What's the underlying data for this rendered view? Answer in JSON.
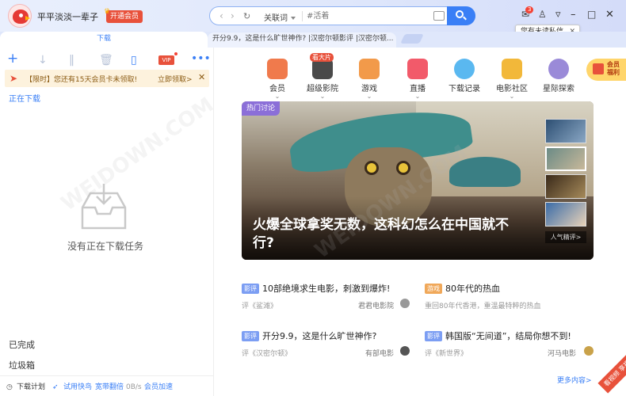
{
  "user": {
    "name": "平平淡淡一辈子",
    "vip_button": "开通会员"
  },
  "search": {
    "keyword_type": "关联词",
    "placeholder": "#活着"
  },
  "notification": {
    "badge": "3",
    "tooltip": "您有未读私信"
  },
  "tabs": [
    {
      "label": "下载"
    },
    {
      "label": "开分9.9，这是什么旷世神作? |汉密尔顿影评 |汉密尔顿..."
    }
  ],
  "toolbar": {
    "vip_label": "VIP"
  },
  "promo": {
    "text": "【限时】您还有15天会员卡未领取!",
    "action": "立即领取>"
  },
  "download": {
    "section_title": "正在下载",
    "empty_text": "没有正在下载任务",
    "completed": "已完成",
    "trash": "垃圾箱"
  },
  "bottom_bar": {
    "plan": "下载计划",
    "speed_label": "试用快鸟",
    "broadband": "宽带翻倍",
    "speed": "0B/s",
    "vip_accel": "会员加速"
  },
  "categories": [
    {
      "label": "会员",
      "color": "#f07a4c",
      "icon": "crown-icon"
    },
    {
      "label": "超级影院",
      "color": "#4a4a4a",
      "icon": "film-icon",
      "badge": "看大片"
    },
    {
      "label": "游戏",
      "color": "#f29a4a",
      "icon": "gamepad-icon"
    },
    {
      "label": "直播",
      "color": "#f25a6a",
      "icon": "tv-icon"
    },
    {
      "label": "下载记录",
      "color": "#5ab8f0",
      "icon": "cloud-icon"
    },
    {
      "label": "电影社区",
      "color": "#f2b83a",
      "icon": "star-icon"
    },
    {
      "label": "星际探索",
      "color": "#9a8ad8",
      "icon": "planet-icon"
    }
  ],
  "vip_corner": {
    "line1": "会员",
    "line2": "福利"
  },
  "banner": {
    "tag": "热门讨论",
    "title": "火爆全球拿奖无数，这科幻怎么在中国就不行?",
    "side_label": "人气精评>"
  },
  "news": [
    {
      "badge": "影评",
      "badge_color": "#7c9ef3",
      "title": "10部绝境求生电影，刺激到爆炸!",
      "sub": "评《鲨滩》",
      "source": "君君电影院"
    },
    {
      "badge": "游戏",
      "badge_color": "#f0a85a",
      "title": "80年代的热血",
      "sub": "重回80年代香港，重温最特粹的热血",
      "source": ""
    },
    {
      "badge": "影评",
      "badge_color": "#7c9ef3",
      "title": "开分9.9，这是什么旷世神作?",
      "sub": "评《汉密尔顿》",
      "source": "有部电影"
    },
    {
      "badge": "影评",
      "badge_color": "#7c9ef3",
      "title": "韩国版“无间道”，结局你想不到!",
      "sub": "评《新世界》",
      "source": "河马电影"
    }
  ],
  "more": "更多内容>",
  "corner_ribbon": "看视频 享福利",
  "watermark": "WEIDOWN.COM"
}
